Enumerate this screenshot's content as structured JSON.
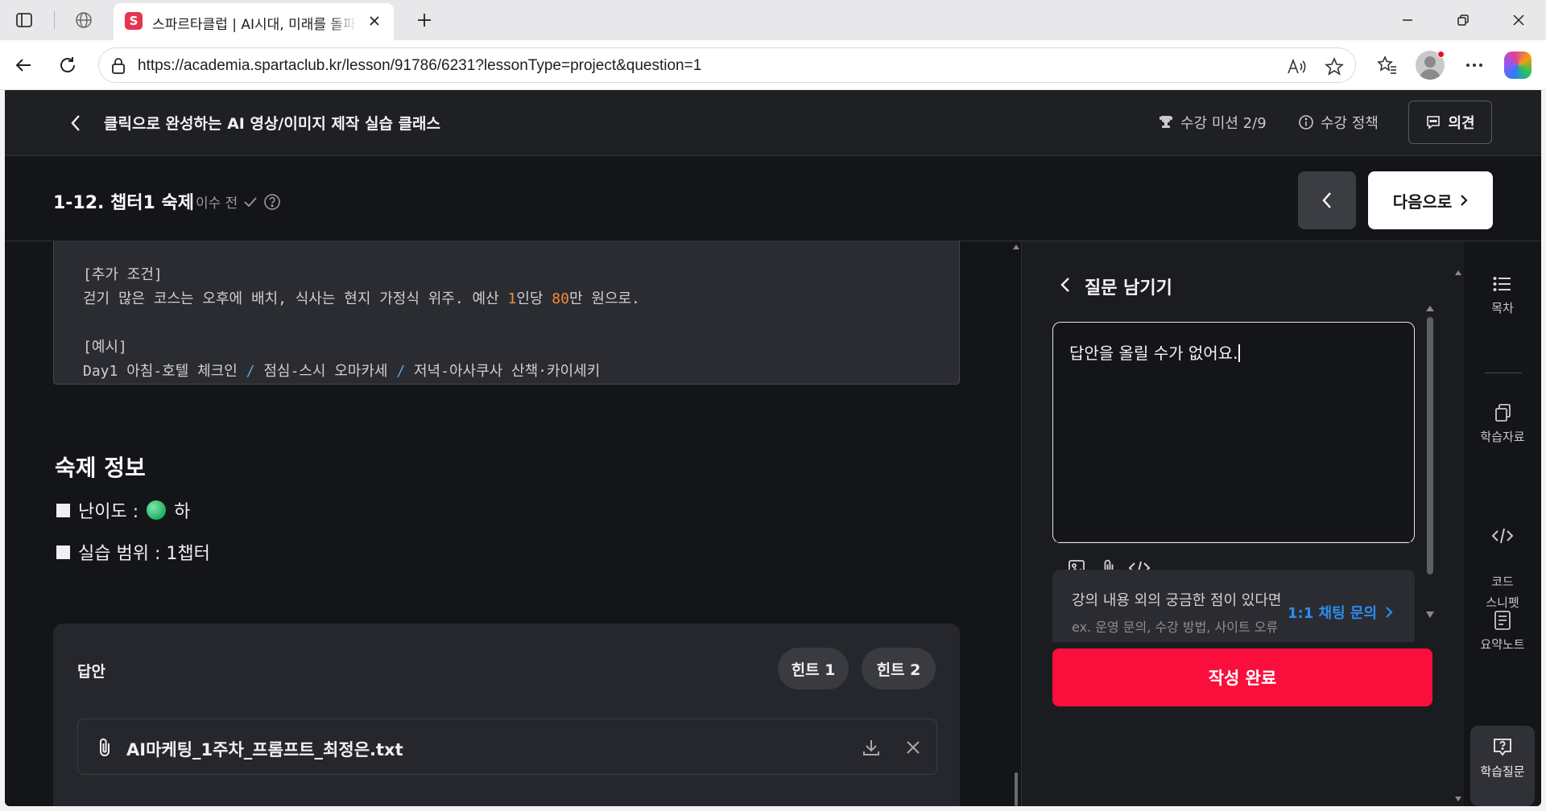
{
  "browser": {
    "tab_title": "스파르타클럽 | AI시대, 미래를 돌파하는",
    "tab_favicon": "S",
    "url": "https://academia.spartaclub.kr/lesson/91786/6231?lessonType=project&question=1"
  },
  "header": {
    "course_title": "클릭으로 완성하는 AI 영상/이미지 제작 실습 클래스",
    "mission_label": "수강 미션 2/9",
    "policy_label": "수강 정책",
    "opinion_label": "의견"
  },
  "lesson": {
    "title": "1-12. 챕터1 숙제",
    "status": "이수 전",
    "next_label": "다음으로"
  },
  "prompt_box": {
    "cond_header": "[추가 조건]",
    "cond_a": "걷기 많은 코스는 오후에 배치, 식사는 현지 가정식 위주. 예산 ",
    "cond_num1": "1",
    "cond_b": "인당 ",
    "cond_num2": "80",
    "cond_c": "만 원으로.",
    "example_header": "[예시]",
    "ex_day": "Day1",
    "ex_1": " 아침-호텔 체크인 ",
    "ex_slash": "/",
    "ex_2": " 점심-스시 오마카세 ",
    "ex_3": " 저녁-아사쿠사 산책·카이세키"
  },
  "homework": {
    "title": "숙제 정보",
    "difficulty_label": "난이도 :",
    "difficulty_value": "하",
    "scope_label": "실습 범위 : 1챕터"
  },
  "answer": {
    "label": "답안",
    "hint1": "힌트 1",
    "hint2": "힌트 2",
    "file_name": "AI마케팅_1주차_프롬프트_최정은.txt"
  },
  "question_panel": {
    "title": "질문 남기기",
    "text": "답안을 올릴 수가 없어요.",
    "info_main": "강의 내용 외의 궁금한 점이 있다면",
    "info_sub": "ex. 운영 문의, 수강 방법, 사이트 오류",
    "chat_link": "1:1 채팅 문의",
    "submit": "작성 완료"
  },
  "rail": [
    {
      "label": "목차"
    },
    {
      "label": "학습자료"
    },
    {
      "label": "코드\n스니펫"
    },
    {
      "label": "요약노트"
    },
    {
      "label": "학습질문"
    }
  ],
  "colors": {
    "accent_red": "#fa0f3c",
    "link_blue": "#2d8cf0",
    "code_number": "#f08a3c",
    "difficulty_green": "#1fb063"
  }
}
